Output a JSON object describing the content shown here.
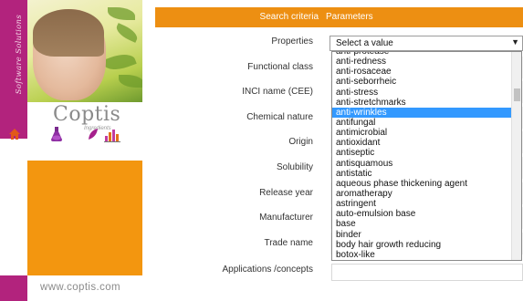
{
  "sidebar": {
    "brand_text": "Software Solutions",
    "logo_text": "Coptis",
    "logo_sub": "Ingredients",
    "url": "www.coptis.com",
    "icons": [
      "home-icon",
      "flask-icon",
      "leaf-icon",
      "bar-chart-icon"
    ],
    "colors": {
      "magenta": "#b2237d",
      "orange": "#f3960f"
    }
  },
  "header": {
    "left": "Search criteria",
    "right": "Parameters",
    "color": "#ed8f12"
  },
  "fields": [
    {
      "label": "Properties"
    },
    {
      "label": "Functional class"
    },
    {
      "label": "INCI name (CEE)"
    },
    {
      "label": "Chemical nature"
    },
    {
      "label": "Origin"
    },
    {
      "label": "Solubility"
    },
    {
      "label": "Release year"
    },
    {
      "label": "Manufacturer"
    },
    {
      "label": "Trade name"
    },
    {
      "label": "Applications /concepts"
    }
  ],
  "properties_select": {
    "value": "Select a value",
    "options": [
      "anti-protease",
      "anti-redness",
      "anti-rosaceae",
      "anti-seborrheic",
      "anti-stress",
      "anti-stretchmarks",
      "anti-wrinkles",
      "antifungal",
      "antimicrobial",
      "antioxidant",
      "antiseptic",
      "antisquamous",
      "antistatic",
      "aqueous phase thickening agent",
      "aromatherapy",
      "astringent",
      "auto-emulsion base",
      "base",
      "binder",
      "body hair growth reducing",
      "botox-like"
    ],
    "highlighted": "anti-wrinkles",
    "highlight_color": "#3399ff"
  }
}
